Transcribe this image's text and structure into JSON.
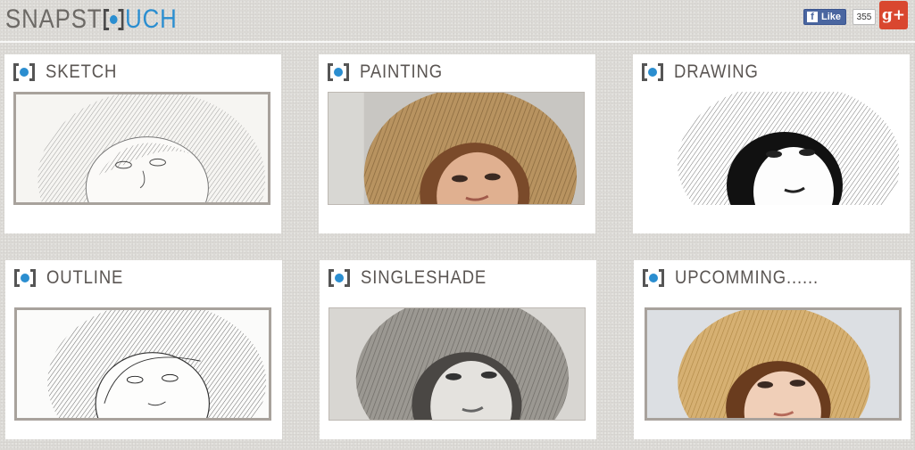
{
  "header": {
    "logo_part1": "SNAPST",
    "logo_part2": "UCH",
    "logo_icon": "camera-bracket-icon",
    "brand_colors": {
      "gray": "#6d6a66",
      "blue": "#2b8ed0"
    }
  },
  "social": {
    "fb_like_label": "Like",
    "fb_like_count": "355",
    "gplus_label": "g+",
    "fb_color": "#4a66a0",
    "gplus_color": "#d9472f"
  },
  "cards": [
    {
      "title": "SKETCH",
      "style": "sketch"
    },
    {
      "title": "PAINTING",
      "style": "painting"
    },
    {
      "title": "DRAWING",
      "style": "drawing"
    },
    {
      "title": "OUTLINE",
      "style": "outline"
    },
    {
      "title": "SINGLESHADE",
      "style": "singleshade"
    },
    {
      "title": "UPCOMMING......",
      "style": "color"
    }
  ]
}
